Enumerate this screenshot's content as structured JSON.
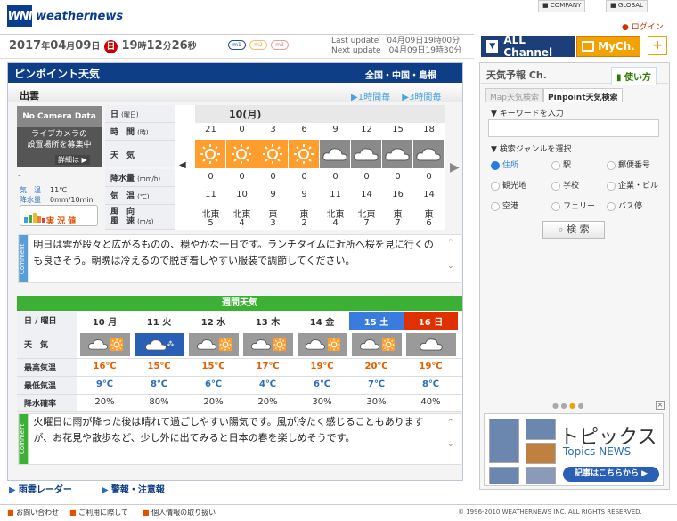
{
  "brand": {
    "logo": "WNI",
    "name": "weathernews"
  },
  "topnav": {
    "company": "COMPANY",
    "global": "GLOBAL",
    "login": "ログイン"
  },
  "timebar": {
    "year": "2017",
    "year_unit": "年",
    "month": "04",
    "month_unit": "月",
    "day": "09",
    "day_unit": "日",
    "weekday": "日",
    "hour": "19",
    "hour_unit": "時",
    "minute": "12",
    "minute_unit": "分",
    "second": "26",
    "second_unit": "秒",
    "modes": [
      "m1",
      "m2",
      "m3"
    ],
    "last_update_label": "Last update",
    "last_update": "04月09日19時00分",
    "next_update_label": "Next update",
    "next_update": "04月09日19時30分"
  },
  "channel_tabs": {
    "all": "ALL Channel",
    "my": "MyCh.",
    "add": "+"
  },
  "main": {
    "title": "ピンポイント天気",
    "region": {
      "nation": "全国",
      "sep1": "・",
      "area": "中国",
      "sep2": "・",
      "pref": "島根"
    },
    "city": "出雲",
    "hour_toggle": {
      "one": "1時間毎",
      "three": "3時間毎"
    },
    "camera": {
      "head": "No Camera Data",
      "msg": "ライブカメラの\n設置場所を募集中",
      "detail": "詳細は"
    },
    "current": {
      "dash": "-",
      "temp_label": "気　温",
      "temp": "11℃",
      "wind_label": "降水量",
      "wind": "0mm/10min",
      "live": "実 況 値"
    },
    "row_labels": {
      "date": "日",
      "date_sub": "(曜日)",
      "time": "時　間",
      "time_sub": "(時)",
      "weather": "天　気",
      "precip": "降水量",
      "precip_sub": "(mm/h)",
      "temp": "気　温",
      "temp_sub": "(℃)",
      "wind": "風　向",
      "wind2": "風　速",
      "wind_sub": "(m/s)"
    },
    "date_header": "10(月)",
    "hours": [
      "21",
      "0",
      "3",
      "6",
      "9",
      "12",
      "15",
      "18"
    ],
    "weather": [
      "sun",
      "sun",
      "sun",
      "sun",
      "cloud",
      "cloud",
      "cloud",
      "cloud"
    ],
    "precip": [
      "0",
      "0",
      "0",
      "0",
      "0",
      "0",
      "0",
      "0"
    ],
    "temps": [
      "11",
      "10",
      "9",
      "9",
      "11",
      "14",
      "16",
      "14"
    ],
    "wind_dir": [
      "北東",
      "北東",
      "東",
      "東",
      "北東",
      "北東",
      "東",
      "東"
    ],
    "wind_speed": [
      "5",
      "4",
      "3",
      "2",
      "4",
      "7",
      "7",
      "6"
    ],
    "comment_tag": "Comment",
    "comment": "明日は雲が段々と広がるものの、穏やかな一日です。ランチタイムに近所へ桜を見に行くのも良さそう。朝晩は冷えるので脱ぎ着しやすい服装で調節してください。"
  },
  "weekly": {
    "title": "週間天気",
    "labels": {
      "date": "日 / 曜日",
      "weather": "天　気",
      "high": "最高気温",
      "low": "最低気温",
      "pop": "降水確率"
    },
    "days": [
      {
        "date": "10",
        "dow": "月",
        "weather": "cloud-sun",
        "high": "16℃",
        "low": "9℃",
        "pop": "20%"
      },
      {
        "date": "11",
        "dow": "火",
        "weather": "rain",
        "high": "15℃",
        "low": "8℃",
        "pop": "80%"
      },
      {
        "date": "12",
        "dow": "水",
        "weather": "cloud-sun",
        "high": "15℃",
        "low": "6℃",
        "pop": "20%"
      },
      {
        "date": "13",
        "dow": "木",
        "weather": "cloud-sun",
        "high": "17℃",
        "low": "4℃",
        "pop": "20%"
      },
      {
        "date": "14",
        "dow": "金",
        "weather": "cloud-sun",
        "high": "19℃",
        "low": "6℃",
        "pop": "30%"
      },
      {
        "date": "15",
        "dow": "土",
        "weather": "cloud-sun",
        "high": "20℃",
        "low": "7℃",
        "pop": "30%"
      },
      {
        "date": "16",
        "dow": "日",
        "weather": "cloud",
        "high": "19℃",
        "low": "8℃",
        "pop": "40%"
      }
    ],
    "comment_tag": "Comment",
    "comment": "火曜日に雨が降った後は晴れて過ごしやすい陽気です。風が冷たく感じることもありますが、お花見や散歩など、少し外に出てみると日本の春を楽しめそうです。"
  },
  "bottom_links": {
    "radar": "雨雲レーダー",
    "warning": "警報・注意報"
  },
  "sidebar": {
    "title": "天気予報 Ch.",
    "howto": "使い方",
    "tabs": {
      "map": "Map天気検索",
      "pinpoint": "Pinpoint天気検索"
    },
    "keyword_label": "▼ キーワードを入力",
    "genre_label": "▼ 検索ジャンルを選択",
    "genres": [
      "住所",
      "駅",
      "郵便番号",
      "観光地",
      "学校",
      "企業・ビル",
      "空港",
      "フェリー",
      "バス停"
    ],
    "search": "検 索",
    "topics_jp": "トピックス",
    "topics_en": "Topics NEWS",
    "topics_btn": "記事はこちらから ▶"
  },
  "footer": {
    "contact": "お問い合わせ",
    "terms": "ご利用に際して",
    "privacy": "個人情報の取り扱い",
    "copyright": "© 1996-2010 WEATHERNEWS INC. ALL RIGHTS RESERVED."
  },
  "colors": {
    "navy": "#0d3e86",
    "orange": "#f2a100",
    "green": "#3cb034",
    "saturday": "#3a7be0",
    "sunday": "#e03000"
  }
}
